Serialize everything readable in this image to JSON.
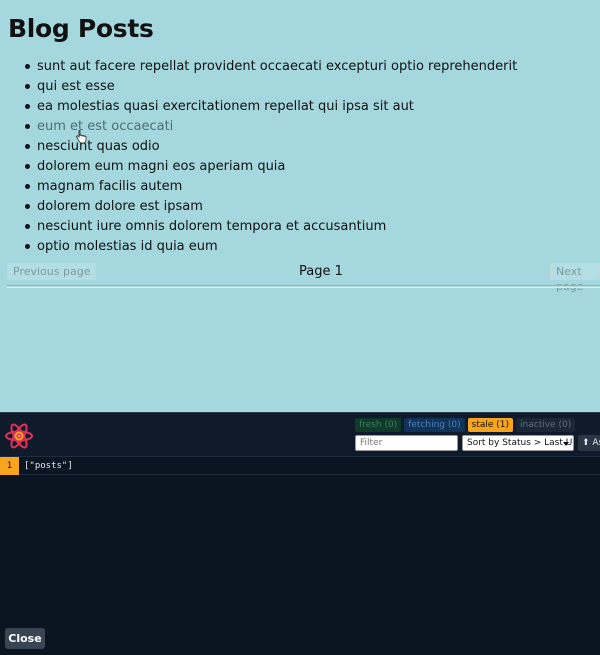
{
  "page": {
    "title": "Blog Posts",
    "posts": [
      "sunt aut facere repellat provident occaecati excepturi optio reprehenderit",
      "qui est esse",
      "ea molestias quasi exercitationem repellat qui ipsa sit aut",
      "eum et est occaecati",
      "nesciunt quas odio",
      "dolorem eum magni eos aperiam quia",
      "magnam facilis autem",
      "dolorem dolore est ipsam",
      "nesciunt iure omnis dolorem tempora et accusantium",
      "optio molestias id quia eum"
    ],
    "pagination": {
      "previous_label": "Previous page",
      "page_label": "Page 1",
      "next_label": "Next page"
    }
  },
  "devtools": {
    "badges": {
      "fresh": "fresh (0)",
      "fetching": "fetching (0)",
      "stale": "stale (1)",
      "inactive": "inactive (0)"
    },
    "filter_placeholder": "Filter",
    "sort_label": "Sort by Status > Last Updated",
    "sort_direction_label": "⬆ Asc",
    "queries": [
      {
        "count": "1",
        "key": "[\"posts\"]"
      }
    ],
    "close_label": "Close"
  },
  "colors": {
    "page_background": "#a5d8de",
    "devtools_background": "#0b1521",
    "stale_accent": "#f8a51d",
    "logo_red": "#e2315a"
  },
  "icons": {
    "logo": "react-query-flower-icon",
    "cursor": "hand-pointer-icon",
    "sort_caret": "caret-down-icon"
  }
}
